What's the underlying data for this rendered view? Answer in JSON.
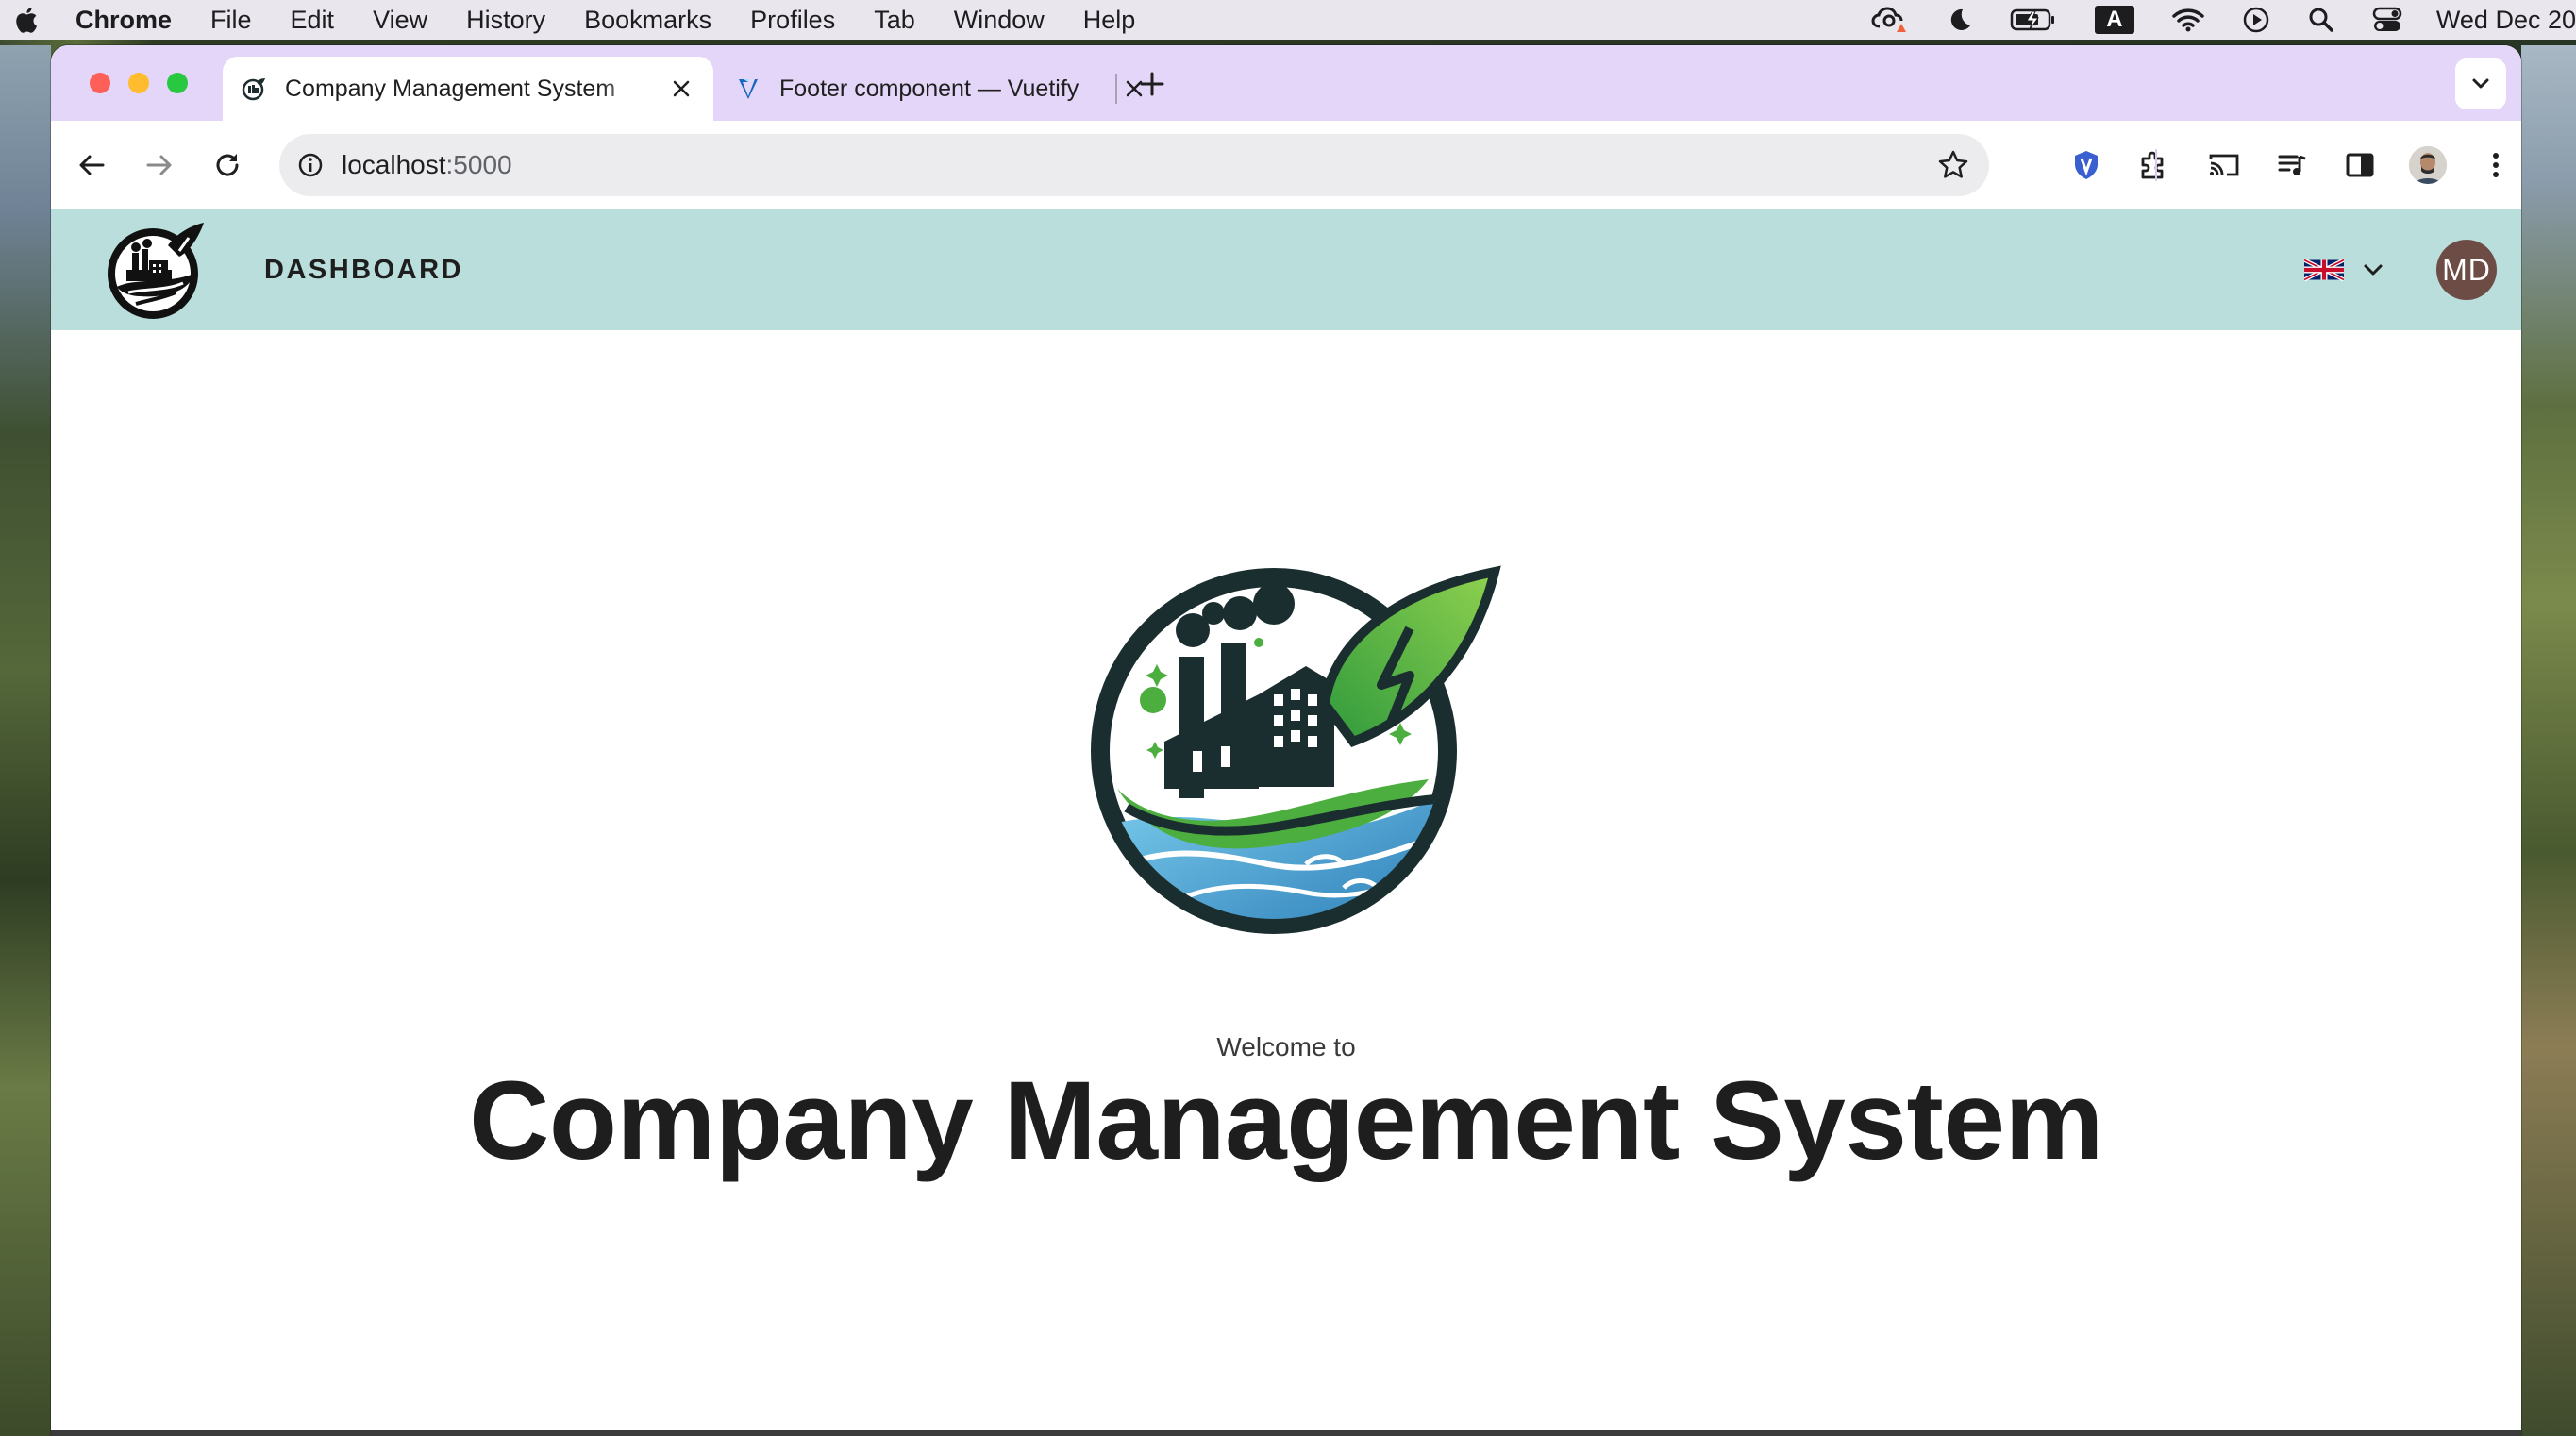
{
  "menubar": {
    "app_name": "Chrome",
    "items": [
      "File",
      "Edit",
      "View",
      "History",
      "Bookmarks",
      "Profiles",
      "Tab",
      "Window",
      "Help"
    ],
    "keyboard_input": "A",
    "clock": "Wed Dec 20"
  },
  "browser": {
    "tabs": [
      {
        "title": "Company Management System",
        "active": true
      },
      {
        "title": "Footer component — Vuetify",
        "active": false
      }
    ],
    "url_host": "localhost",
    "url_port": ":5000"
  },
  "app": {
    "nav_label": "DASHBOARD",
    "language": "English (UK)",
    "user_initials": "MD",
    "brand_color": "#b9dedb",
    "avatar_color": "#6d4c45"
  },
  "hero": {
    "welcome": "Welcome to",
    "title": "Company Management System"
  }
}
